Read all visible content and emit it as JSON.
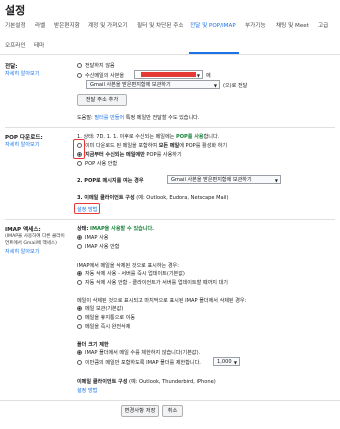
{
  "page": {
    "title": "설정"
  },
  "tabs": [
    {
      "label": "기본설정"
    },
    {
      "label": "라벨"
    },
    {
      "label": "받은편지함"
    },
    {
      "label": "계정 및 가져오기"
    },
    {
      "label": "필터 및 차단된 주소"
    },
    {
      "label": "전달 및 POP/IMAP"
    },
    {
      "label": "부가기능"
    },
    {
      "label": "채팅 및 Meet"
    },
    {
      "label": "고급"
    },
    {
      "label": "오프라인"
    },
    {
      "label": "테마"
    }
  ],
  "forwarding": {
    "label": "전달:",
    "learn_more": "자세히 알아보기",
    "opt_off": "전달하지 않음",
    "opt_on_prefix": "수신메일의 사본을",
    "opt_on_suffix": "에",
    "action_select": "Gmail 사본을 받은편지함에 보관하기",
    "action_tail": "(으)로 전달",
    "add_button": "전달 주소 추가",
    "tip_prefix": "도움말:",
    "tip_link": "필터를 만들어",
    "tip_suffix": "특정 메일만 전달할 수도 있습니다."
  },
  "pop": {
    "label": "POP 다운로드:",
    "learn_more": "자세히 알아보기",
    "status_prefix": "1. 상태:",
    "status_text": "7D. 1. 1. 이후로 수신되는 메일에는",
    "status_strong": "POP를 사용",
    "status_end": "합니다.",
    "opt1_pre": "이미 다운로드 된 메일을 포함하여",
    "opt1_bold": "모든 메일",
    "opt1_post": "에 POP를 활성화 하기",
    "opt2_bold": "지금부터 수신되는 메일에만",
    "opt2_post": "POP를 사용하기",
    "opt3": "POP 사용 안함",
    "step2_prefix": "2. POP로 메시지를 여는 경우",
    "step2_select": "Gmail 사본을 받은편지함에 보관하기",
    "step3_bold": "3. 이메일 클라이언트 구성",
    "step3_rest": "(예: Outlook, Eudora, Netscape Mail)",
    "setup_link": "설정 방법"
  },
  "imap": {
    "label": "IMAP 액세스:",
    "sub1": "(IMAP을 사용하여 다른 클라이",
    "sub2": "언트에서 Gmail에 액세스)",
    "learn_more": "자세히 알아보기",
    "status_prefix": "상태:",
    "status_text": "IMAP을 사용할 수 있습니다.",
    "opt_on": "IMAP 사용",
    "opt_off": "IMAP 사용 안함",
    "delete_title": "IMAP에서 메일을 삭제된 것으로 표시하는 경우:",
    "delete_opt1": "자동 삭제 사용 - 서버를 즉시 업데이트(기본값)",
    "delete_opt2": "자동 삭제 사용 안함 - 클라이언트가 서버를 업데이트할 때까지 대기",
    "expunge_title": "메일이 삭제된 것으로 표시되고 마지막으로 표시된 IMAP 폴더에서 삭제된 경우:",
    "expunge_opt1": "메일 보관(기본값)",
    "expunge_opt2": "메일을 휴지통으로 이동",
    "expunge_opt3": "메일을 즉시 완전삭제",
    "folder_title": "폴더 크기 제한",
    "folder_opt1": "IMAP 폴더에서 메일 수를 제한하지 않습니다(기본값).",
    "folder_opt2": "이만큼의 메일만 포함하도록 IMAP 폴더를 제한합니다.",
    "folder_select": "1,000",
    "client_bold": "이메일 클라이언트 구성",
    "client_rest": "(예: Outlook, Thunderbird, iPhone)",
    "setup_link": "설정 방법"
  },
  "footer": {
    "save": "변경사항 저장",
    "cancel": "취소"
  }
}
